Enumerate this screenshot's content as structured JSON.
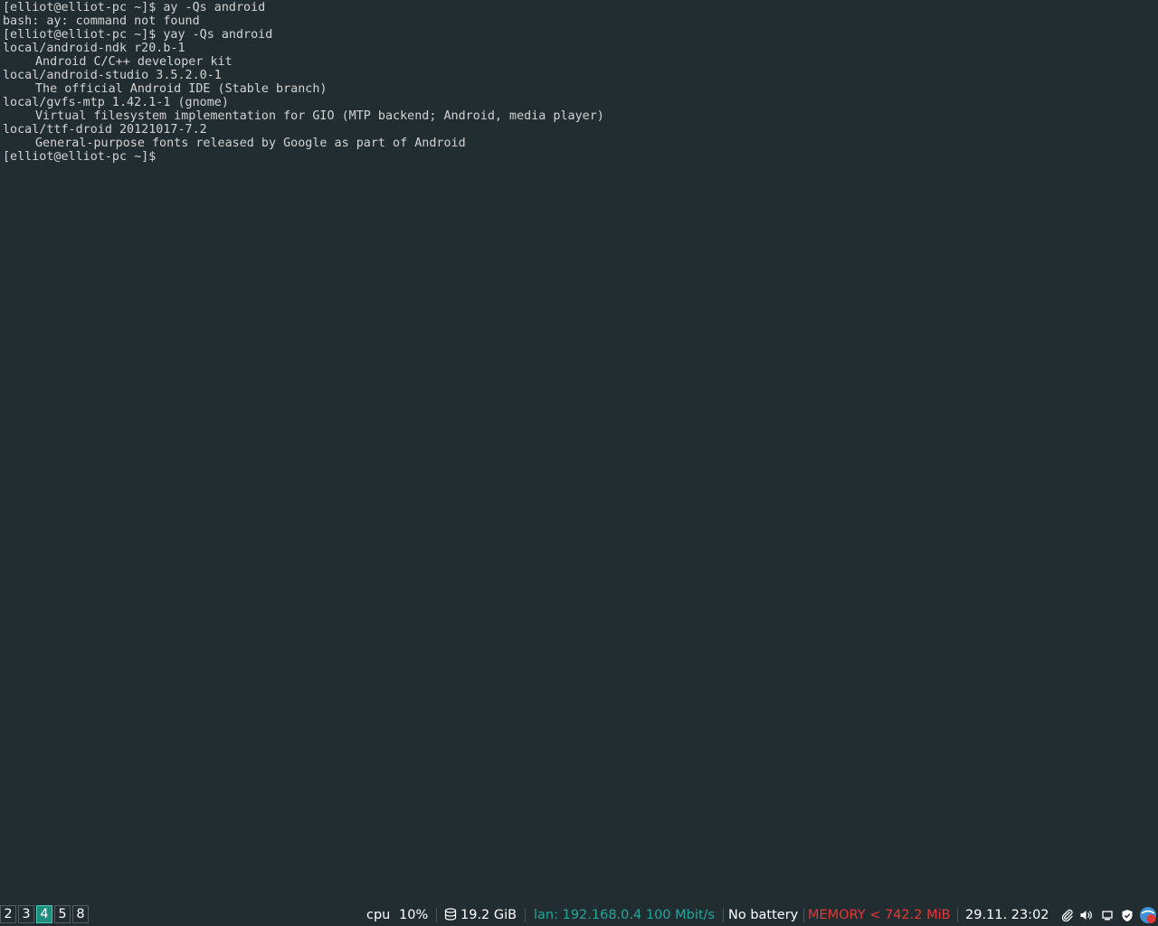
{
  "terminal": {
    "lines": [
      {
        "kind": "prompt",
        "prompt": "[elliot@elliot-pc ~]$",
        "cmd": " ay -Qs android"
      },
      {
        "kind": "out",
        "text": "bash: ay: command not found"
      },
      {
        "kind": "prompt",
        "prompt": "[elliot@elliot-pc ~]$",
        "cmd": " yay -Qs android"
      },
      {
        "kind": "out",
        "text": "local/android-ndk r20.b-1"
      },
      {
        "kind": "desc",
        "text": "Android C/C++ developer kit"
      },
      {
        "kind": "out",
        "text": "local/android-studio 3.5.2.0-1"
      },
      {
        "kind": "desc",
        "text": "The official Android IDE (Stable branch)"
      },
      {
        "kind": "out",
        "text": "local/gvfs-mtp 1.42.1-1 (gnome)"
      },
      {
        "kind": "desc",
        "text": "Virtual filesystem implementation for GIO (MTP backend; Android, media player)"
      },
      {
        "kind": "out",
        "text": "local/ttf-droid 20121017-7.2"
      },
      {
        "kind": "desc",
        "text": "General-purpose fonts released by Google as part of Android"
      },
      {
        "kind": "prompt",
        "prompt": "[elliot@elliot-pc ~]$",
        "cmd": ""
      }
    ]
  },
  "bar": {
    "workspaces": [
      {
        "label": "2",
        "active": false
      },
      {
        "label": "3",
        "active": false
      },
      {
        "label": "4",
        "active": true
      },
      {
        "label": "5",
        "active": false
      },
      {
        "label": "8",
        "active": false
      }
    ],
    "cpu_label": "cpu",
    "cpu_value": "10%",
    "disk_icon": "disk-icon",
    "disk_value": "19.2 GiB",
    "lan": "lan: 192.168.0.4 100 Mbit/s",
    "battery": "No battery",
    "memory": "MEMORY < 742.2 MiB",
    "datetime": "29.11. 23:02",
    "tray_icons": [
      "paperclip-icon",
      "volume-icon",
      "display-icon",
      "shield-check-icon",
      "app-badge-icon"
    ],
    "colors": {
      "background": "#222d32",
      "lan": "#26a69a",
      "memory": "#e53935",
      "active_workspace": "#1e8f7f",
      "text": "#ffffff"
    }
  }
}
